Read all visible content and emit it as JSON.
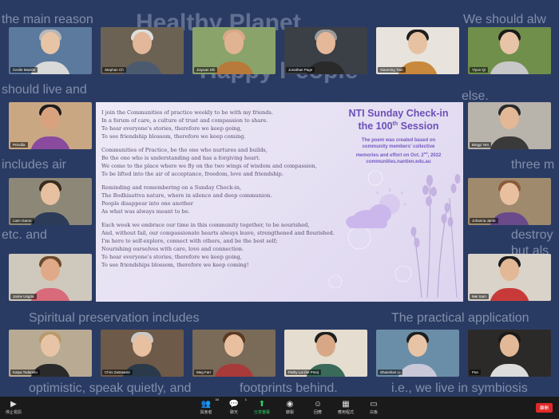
{
  "background_slide": {
    "title": "Healthy Planet",
    "title2": "Happy People",
    "fragments_left": [
      "the main reason",
      "should live and",
      "includes air",
      "etc. and",
      "Spiritual preservation includes",
      "optimistic, speak quietly, and"
    ],
    "fragments_right": [
      "We should alw",
      "else.",
      "three m",
      "destroy",
      "but als",
      "The practical application",
      "i.e., we live in symbiosis",
      "footprints behind."
    ]
  },
  "participants": [
    {
      "name": "Cecile Mackle",
      "tile_bg": "#5c7a9e",
      "skin": "#e8c4a6",
      "hair": "#b8b8b8",
      "shirt": "#d9d9d9"
    },
    {
      "name": "Stephan Ch",
      "tile_bg": "#6b6253",
      "skin": "#e2b79a",
      "hair": "#dedede",
      "shirt": "#4c5a70"
    },
    {
      "name": "Jiayuan Shi",
      "tile_bg": "#8aa36a",
      "skin": "#e0b493",
      "hair": "#d8a888",
      "shirt": "#b87a3a"
    },
    {
      "name": "Jonathan Page",
      "tile_bg": "#3b3f46",
      "skin": "#e6b89a",
      "hair": "#9a9a9a",
      "shirt": "#2a2a2a"
    },
    {
      "name": "Xiaoming Tian",
      "tile_bg": "#e8e4dd",
      "skin": "#e6c2a2",
      "hair": "#1e1e1e",
      "shirt": "#c9893d"
    },
    {
      "name": "Yiyun Qi",
      "tile_bg": "#6f8f4a",
      "skin": "#e8c4a6",
      "hair": "#1a1a1a",
      "shirt": "#c8c8c8"
    },
    {
      "name": "Priscilla",
      "tile_bg": "#caa783",
      "skin": "#d9a27f",
      "hair": "#1c1c1c",
      "shirt": "#8a4a9e"
    },
    {
      "name": "Bingyi Yen",
      "tile_bg": "#b8b3ab",
      "skin": "#e2b896",
      "hair": "#2a2a2a",
      "shirt": "#3a3a3a"
    },
    {
      "name": "Liam Garon",
      "tile_bg": "#8d8778",
      "skin": "#e6c0a0",
      "hair": "#3a2a1e",
      "shirt": "#2c3c58"
    },
    {
      "name": "Johanna Jamb",
      "tile_bg": "#a08a6e",
      "skin": "#e8c0a0",
      "hair": "#8a5a3a",
      "shirt": "#6a4a8a"
    },
    {
      "name": "Jaime Ungria",
      "tile_bg": "#cfc8bc",
      "skin": "#e0aa88",
      "hair": "#6a4a2a",
      "shirt": "#d86a7a"
    },
    {
      "name": "Mei Sam",
      "tile_bg": "#d9d3c9",
      "skin": "#e2b896",
      "hair": "#1c1c1c",
      "shirt": "#c83a3a"
    },
    {
      "name": "Katya Todarello",
      "tile_bg": "#b9aa94",
      "skin": "#e8c4a6",
      "hair": "#b89a6a",
      "shirt": "#2a2a2a"
    },
    {
      "name": "Chris Zastawski",
      "tile_bg": "#6e5a48",
      "skin": "#e6c0a0",
      "hair": "#c8c8c8",
      "shirt": "#2a3a4a"
    },
    {
      "name": "Meg Farr",
      "tile_bg": "#7a6a58",
      "skin": "#e8c0a0",
      "hair": "#5a3a22",
      "shirt": "#a83a3a"
    },
    {
      "name": "Pathy Lai (he Pnia)",
      "tile_bg": "#e4ddd0",
      "skin": "#d8a886",
      "hair": "#1e1e1e",
      "shirt": "#3a6a5a"
    },
    {
      "name": "Shanshan Li",
      "tile_bg": "#6a8ea8",
      "skin": "#e8c4a6",
      "hair": "#1e1e1e",
      "shirt": "#c8c8d8"
    },
    {
      "name": "Pan",
      "tile_bg": "#2c2a28",
      "skin": "#e2b896",
      "hair": "#1a1a1a",
      "shirt": "#dcdcdc"
    }
  ],
  "shared_slide": {
    "title_line1": "NTI Sunday Check-in",
    "title_line2_pre": "the 100",
    "title_line2_sup": "th",
    "title_line2_post": " Session",
    "sub_line1": "The poem was created based on",
    "sub_line2": "community members' collective",
    "sub_line3_pre": "memories and effort on Oct. 2",
    "sub_line3_sup": "nd",
    "sub_line3_post": ", 2022",
    "sub_line4": "communities.nantien.edu.au",
    "stanzas": [
      [
        "I join the Communities of practice weekly to be with my friends.",
        "In a forum of care, a culture of trust and compassion to share.",
        "To hear everyone's stories, therefore we keep going,",
        "To see friendship blossom, therefore we keep coming."
      ],
      [
        "Communities of Practice, be the one who nurtures and builds,",
        "Be the one who is understanding and has a forgiving heart.",
        "We come to the place where we fly on the two wings of wisdom and compassion,",
        "To be lifted into the air of acceptance, freedom, love and friendship."
      ],
      [
        "Reminding and remembering on a Sunday Check-in,",
        "The Bodhisattva nature, where in silence and deep communion.",
        "People disappear into one another",
        "As what was always meant to be."
      ],
      [
        "Each week we embrace our time in this community together, to be nourished,",
        "And, without fail, our compassionate hearts always leave, strengthened and flourished.",
        "I'm here to self-explore, connect with others, and be the best self;",
        "Nourishing ourselves with care, love and connection.",
        "To hear everyone's stories, therefore we keep going,",
        "To see friendships blossom, therefore we keep coming!"
      ]
    ]
  },
  "toolbar": {
    "left": [
      {
        "label": "停止視訊",
        "icon": "video-camera-icon",
        "glyph": "▶"
      }
    ],
    "center": [
      {
        "label": "與會者",
        "icon": "participants-icon",
        "glyph": "👥",
        "badge": "34"
      },
      {
        "label": "聊天",
        "icon": "chat-icon",
        "glyph": "💬",
        "badge": "1"
      },
      {
        "label": "分享螢幕",
        "icon": "share-screen-icon",
        "glyph": "⬆",
        "active": true
      },
      {
        "label": "錄製",
        "icon": "record-icon",
        "glyph": "◉"
      },
      {
        "label": "回應",
        "icon": "reactions-icon",
        "glyph": "☺"
      },
      {
        "label": "應用程式",
        "icon": "apps-icon",
        "glyph": "▦"
      },
      {
        "label": "白板",
        "icon": "whiteboard-icon",
        "glyph": "▭"
      }
    ],
    "leave_label": "離開",
    "accent": "#2bd46a",
    "leave_color": "#e02828"
  }
}
